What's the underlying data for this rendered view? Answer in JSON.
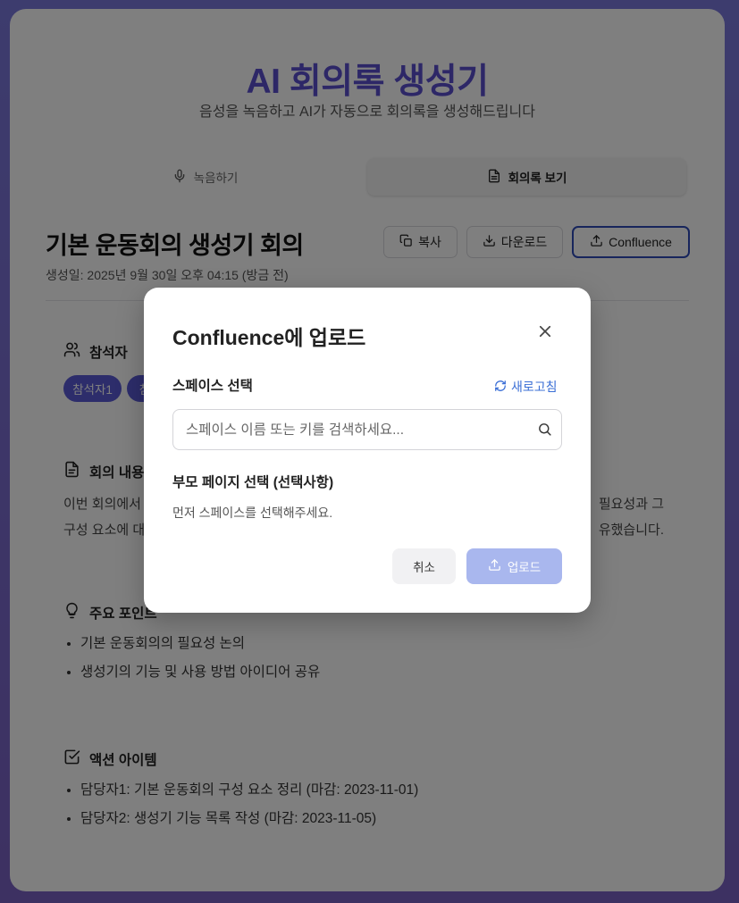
{
  "app": {
    "title": "AI 회의록 생성기",
    "subtitle": "음성을 녹음하고 AI가 자동으로 회의록을 생성해드립니다"
  },
  "tabs": [
    {
      "label": "녹음하기",
      "icon": "mic-icon",
      "active": false
    },
    {
      "label": "회의록 보기",
      "icon": "document-icon",
      "active": true
    }
  ],
  "document": {
    "title": "기본 운동회의 생성기 회의",
    "created": "생성일: 2025년 9월 30일 오후 04:15 (방금 전)"
  },
  "actions": {
    "copy_label": "복사",
    "download_label": "다운로드",
    "confluence_label": "Confluence"
  },
  "sections": {
    "attendees": {
      "heading": "참석자",
      "chips": [
        "참석자1",
        "참"
      ]
    },
    "content": {
      "heading": "회의 내용",
      "line1_left": "이번 회의에서",
      "line1_right": "필요성과 그",
      "line2_left": "구성 요소에 대",
      "line2_right": "유했습니다."
    },
    "key_points": {
      "heading": "주요 포인트",
      "items": [
        "기본 운동회의의 필요성 논의",
        "생성기의 기능 및 사용 방법 아이디어 공유"
      ]
    },
    "action_items": {
      "heading": "액션 아이템",
      "items": [
        "담당자1: 기본 운동회의 구성 요소 정리 (마감: 2023-11-01)",
        "담당자2: 생성기 기능 목록 작성 (마감: 2023-11-05)"
      ]
    }
  },
  "modal": {
    "title": "Confluence에 업로드",
    "space_label": "스페이스 선택",
    "refresh_label": "새로고침",
    "search_placeholder": "스페이스 이름 또는 키를 검색하세요...",
    "search_value": "",
    "parent_label": "부모 페이지 선택 (선택사항)",
    "parent_hint": "먼저 스페이스를 선택해주세요.",
    "cancel_label": "취소",
    "upload_label": "업로드"
  },
  "colors": {
    "accent": "#5b4fcf",
    "chip": "#5b5bd6",
    "confluence_border": "#2f4bb8",
    "upload_disabled": "#a9b7ee",
    "link": "#3b6fd6"
  }
}
